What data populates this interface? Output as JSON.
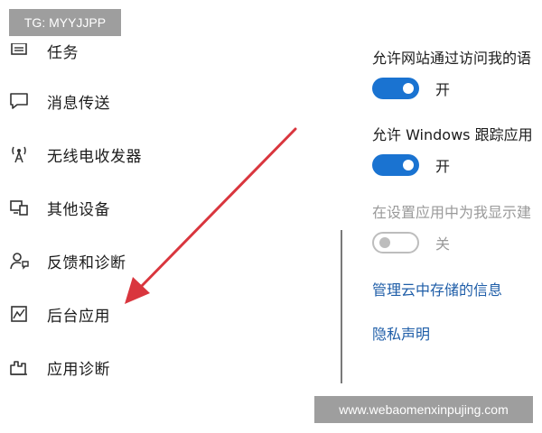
{
  "watermarks": {
    "top": "TG: MYYJJPP",
    "bottom": "www.webaomenxinpujing.com"
  },
  "sidebar": {
    "items": [
      {
        "label": "任务",
        "icon": "tasks-icon"
      },
      {
        "label": "消息传送",
        "icon": "message-icon"
      },
      {
        "label": "无线电收发器",
        "icon": "radio-antenna-icon"
      },
      {
        "label": "其他设备",
        "icon": "devices-icon"
      },
      {
        "label": "反馈和诊断",
        "icon": "feedback-icon"
      },
      {
        "label": "后台应用",
        "icon": "background-apps-icon"
      },
      {
        "label": "应用诊断",
        "icon": "app-diagnostics-icon"
      }
    ]
  },
  "settings": {
    "website_access": {
      "label": "允许网站通过访问我的语",
      "state": "开",
      "on": true
    },
    "windows_tracking": {
      "label": "允许 Windows 跟踪应用",
      "state": "开",
      "on": true
    },
    "show_suggestions": {
      "label": "在设置应用中为我显示建",
      "state": "关",
      "on": false
    },
    "manage_cloud_link": "管理云中存储的信息",
    "privacy_link": "隐私声明"
  },
  "colors": {
    "accent": "#1a73d1",
    "link": "#1f5ea8",
    "arrow": "#d9363e"
  }
}
